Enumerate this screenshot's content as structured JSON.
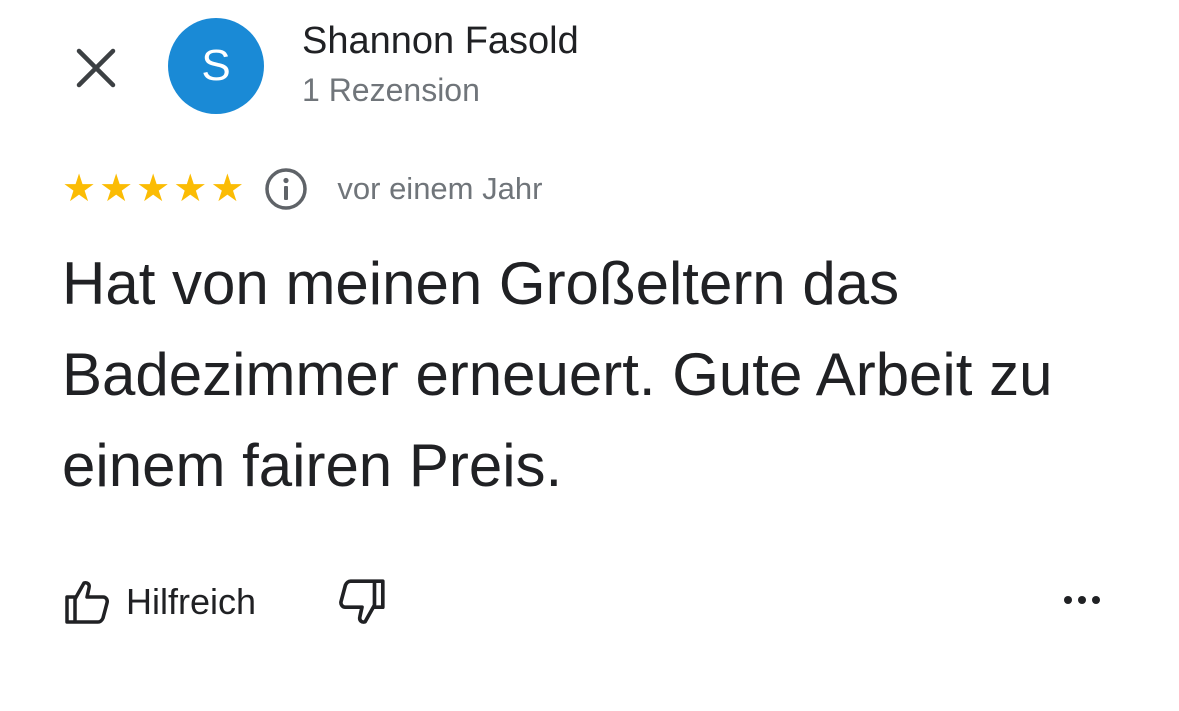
{
  "header": {
    "close_icon": "close-icon",
    "avatar": {
      "initial": "S",
      "color": "#1a8ad6"
    },
    "author_name": "Shannon Fasold",
    "review_count": "1 Rezension"
  },
  "review": {
    "rating": 5,
    "max_rating": 5,
    "star_color": "#fbbc04",
    "info_icon": "info-icon",
    "date": "vor einem Jahr",
    "text": "Hat von meinen Großeltern das Badezimmer erneuert. Gute Arbeit zu einem fairen Preis."
  },
  "actions": {
    "helpful_label": "Hilfreich",
    "helpful_icon": "thumbs-up-icon",
    "dislike_icon": "thumbs-down-icon",
    "more_icon": "more-horizontal-icon"
  }
}
